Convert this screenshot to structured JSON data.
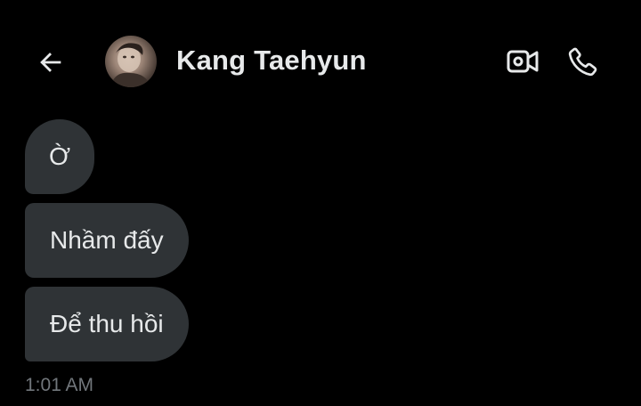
{
  "header": {
    "contact_name": "Kang Taehyun",
    "back_icon": "arrow-left-icon",
    "avatar_icon": "avatar",
    "video_icon": "video-camera-icon",
    "call_icon": "phone-icon"
  },
  "messages": [
    {
      "text": "Ờ"
    },
    {
      "text": "Nhầm đấy"
    },
    {
      "text": "Để thu hồi"
    }
  ],
  "timestamp": "1:01 AM",
  "colors": {
    "background": "#000000",
    "bubble": "#2f3336",
    "text": "#e7e9ea",
    "muted": "#71767b"
  }
}
